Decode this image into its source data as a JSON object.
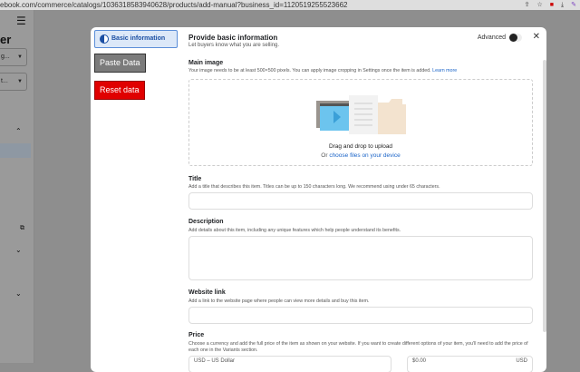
{
  "browser": {
    "url": "ebook.com/commerce/catalogs/1036318583940628/products/add-manual?business_id=1120519255523662"
  },
  "sidebar": {
    "title_fragment": "er",
    "dropdown1": "g...",
    "dropdown2": "t..."
  },
  "modal": {
    "tabs": {
      "basic": "Basic information",
      "paste": "Paste Data",
      "reset": "Reset data"
    },
    "header": {
      "title": "Provide basic information",
      "subtitle": "Let buyers know what you are selling.",
      "advanced_label": "Advanced",
      "advanced_on": false
    },
    "main_image": {
      "label": "Main image",
      "hint": "Your image needs to be at least 500×500 pixels. You can apply image cropping in Settings once the item is added.",
      "learn_more": "Learn more",
      "drag_text": "Drag and drop to upload",
      "or": "Or",
      "choose": "choose files on your device"
    },
    "title": {
      "label": "Title",
      "hint": "Add a title that describes this item. Titles can be up to 150 characters long. We recommend using under 65 characters.",
      "value": ""
    },
    "description": {
      "label": "Description",
      "hint": "Add details about this item, including any unique features which help people understand its benefits.",
      "value": ""
    },
    "website": {
      "label": "Website link",
      "hint": "Add a link to the website page where people can view more details and buy this item.",
      "value": ""
    },
    "price": {
      "label": "Price",
      "hint": "Choose a currency and add the full price of the item as shown on your website. If you want to create different options of your item, you'll need to add the price of each one in the Variants section.",
      "currency": "USD – US Dollar",
      "amount": "$0.00",
      "unit": "USD"
    }
  }
}
